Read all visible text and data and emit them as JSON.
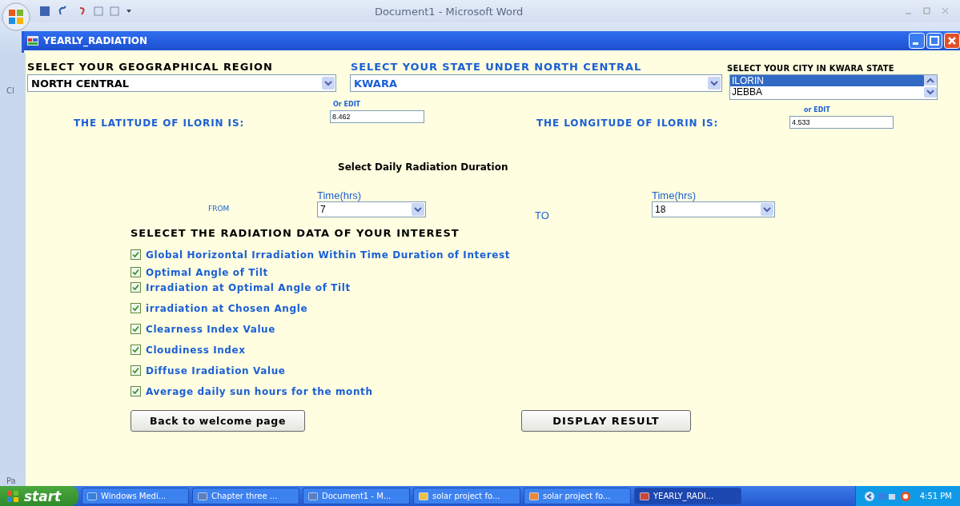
{
  "word_window": {
    "title": "Document1 - Microsoft Word",
    "side_fragments": [
      "Cl",
      "Pa"
    ]
  },
  "dialog": {
    "title": "YEARLY_RADIATION"
  },
  "region": {
    "label": "SELECT YOUR GEOGRAPHICAL REGION",
    "value": "NORTH CENTRAL"
  },
  "state": {
    "label": "SELECT YOUR STATE UNDER NORTH CENTRAL",
    "value": "KWARA"
  },
  "city": {
    "label": "SELECT YOUR CITY IN KWARA STATE",
    "options": [
      {
        "label": "ILORIN",
        "selected": true
      },
      {
        "label": "JEBBA",
        "selected": false
      }
    ]
  },
  "latitude": {
    "label": "THE LATITUDE OF ILORIN IS:",
    "hint": "Or EDIT",
    "value": "8.462"
  },
  "longitude": {
    "label": "THE LONGITUDE OF ILORIN IS:",
    "hint": "or EDIT",
    "value": "4.533"
  },
  "duration": {
    "title": "Select Daily Radiation Duration",
    "from_label": "FROM",
    "to_label": "TO",
    "from": {
      "caption": "Time(hrs)",
      "value": "7"
    },
    "to": {
      "caption": "Time(hrs)",
      "value": "18"
    }
  },
  "data_heading": "SELECET THE RADIATION DATA OF YOUR INTEREST",
  "options": [
    {
      "label": "Global Horizontal Irradiation Within Time Duration of Interest",
      "checked": true
    },
    {
      "label": "Optimal Angle of Tilt",
      "checked": true
    },
    {
      "label": "Irradiation at Optimal Angle of Tilt",
      "checked": true
    },
    {
      "label": "irradiation at Chosen Angle",
      "checked": true
    },
    {
      "label": "Clearness Index Value",
      "checked": true
    },
    {
      "label": "Cloudiness Index",
      "checked": true
    },
    {
      "label": "Diffuse Iradiation Value",
      "checked": true
    },
    {
      "label": "Average daily sun hours for the month",
      "checked": true
    }
  ],
  "buttons": [
    "Back to welcome page",
    "DISPLAY RESULT"
  ],
  "taskbar": {
    "start": "start",
    "tasks": [
      {
        "label": "Windows Medi...",
        "selected": false
      },
      {
        "label": "Chapter three ...",
        "selected": false
      },
      {
        "label": "Document1 - M...",
        "selected": false
      },
      {
        "label": "solar project fo...",
        "selected": false
      },
      {
        "label": "solar project fo...",
        "selected": false
      },
      {
        "label": "YEARLY_RADI...",
        "selected": true
      }
    ],
    "clock": "4:51 PM"
  }
}
